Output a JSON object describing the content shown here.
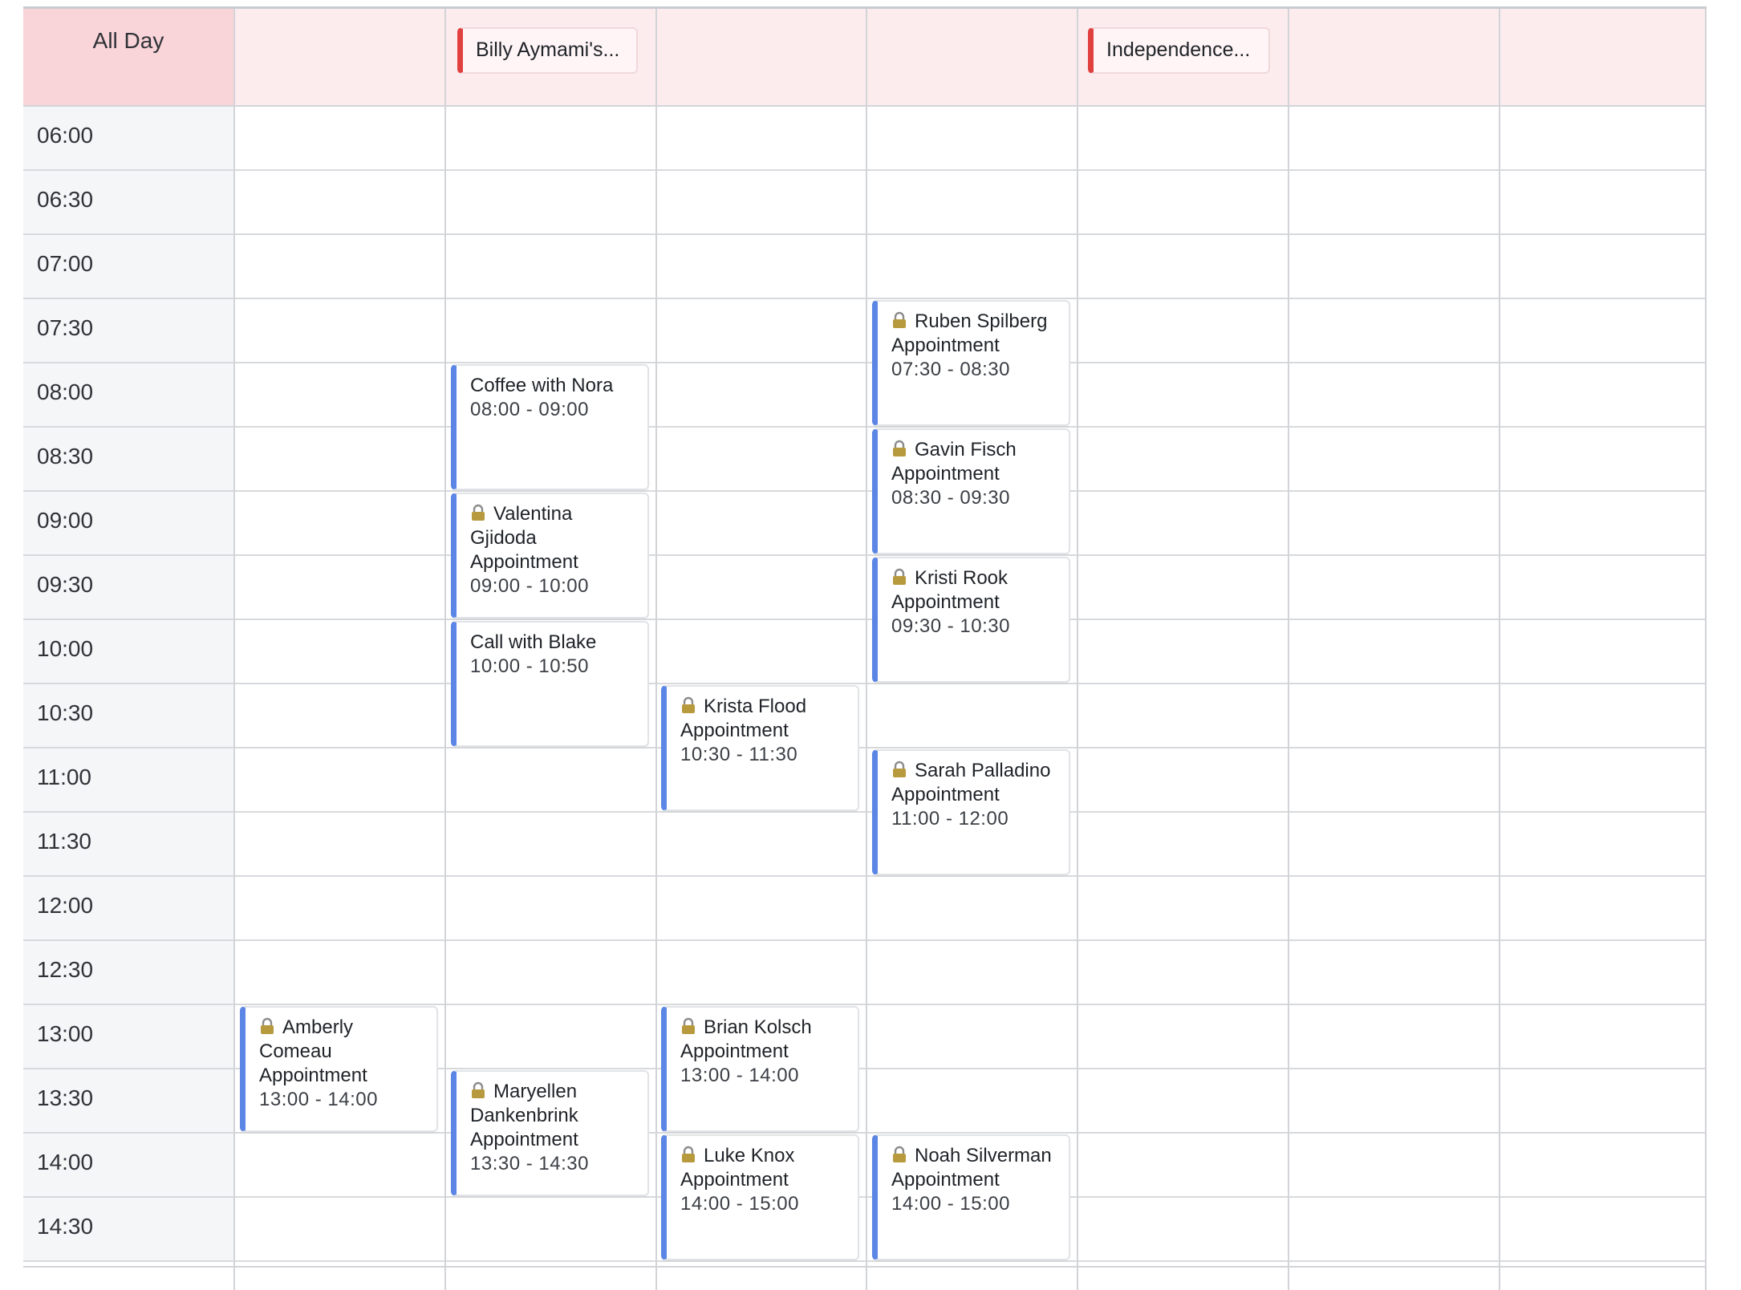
{
  "calendar": {
    "all_day_label": "All Day",
    "all_day_events": [
      {
        "label": "Billy Aymami's...",
        "color": "#e0413f"
      },
      {
        "label": "Independence...",
        "color": "#e0413f"
      }
    ],
    "time_slots": [
      "06:00",
      "06:30",
      "07:00",
      "07:30",
      "08:00",
      "08:30",
      "09:00",
      "09:30",
      "10:00",
      "10:30",
      "11:00",
      "11:30",
      "12:00",
      "12:30",
      "13:00",
      "13:30",
      "14:00",
      "14:30"
    ],
    "events": [
      {
        "title": "Coffee with Nora",
        "time": "08:00 - 09:00",
        "locked": false
      },
      {
        "title": "Valentina Gjidoda Appointment",
        "time": "09:00 - 10:00",
        "locked": true
      },
      {
        "title": "Call with Blake",
        "time": "10:00 - 10:50",
        "locked": false
      },
      {
        "title": "Ruben Spilberg Appointment",
        "time": "07:30 - 08:30",
        "locked": true
      },
      {
        "title": "Gavin Fisch Appointment",
        "time": "08:30 - 09:30",
        "locked": true
      },
      {
        "title": "Kristi Rook Appointment",
        "time": "09:30 - 10:30",
        "locked": true
      },
      {
        "title": "Krista Flood Appointment",
        "time": "10:30 - 11:30",
        "locked": true
      },
      {
        "title": "Sarah Palladino Appointment",
        "time": "11:00 - 12:00",
        "locked": true
      },
      {
        "title": "Amberly Comeau Appointment",
        "time": "13:00 - 14:00",
        "locked": true
      },
      {
        "title": "Brian Kolsch Appointment",
        "time": "13:00 - 14:00",
        "locked": true
      },
      {
        "title": "Maryellen Dankenbrink Appointment",
        "time": "13:30 - 14:30",
        "locked": true
      },
      {
        "title": "Luke Knox Appointment",
        "time": "14:00 - 15:00",
        "locked": true
      },
      {
        "title": "Noah Silverman Appointment",
        "time": "14:00 - 15:00",
        "locked": true
      }
    ],
    "colors": {
      "event_accent": "#5b86e5",
      "holiday_accent": "#e0413f",
      "all_day_bg": "#fcecee"
    },
    "icons": {
      "locked_event": "lock-icon"
    }
  }
}
